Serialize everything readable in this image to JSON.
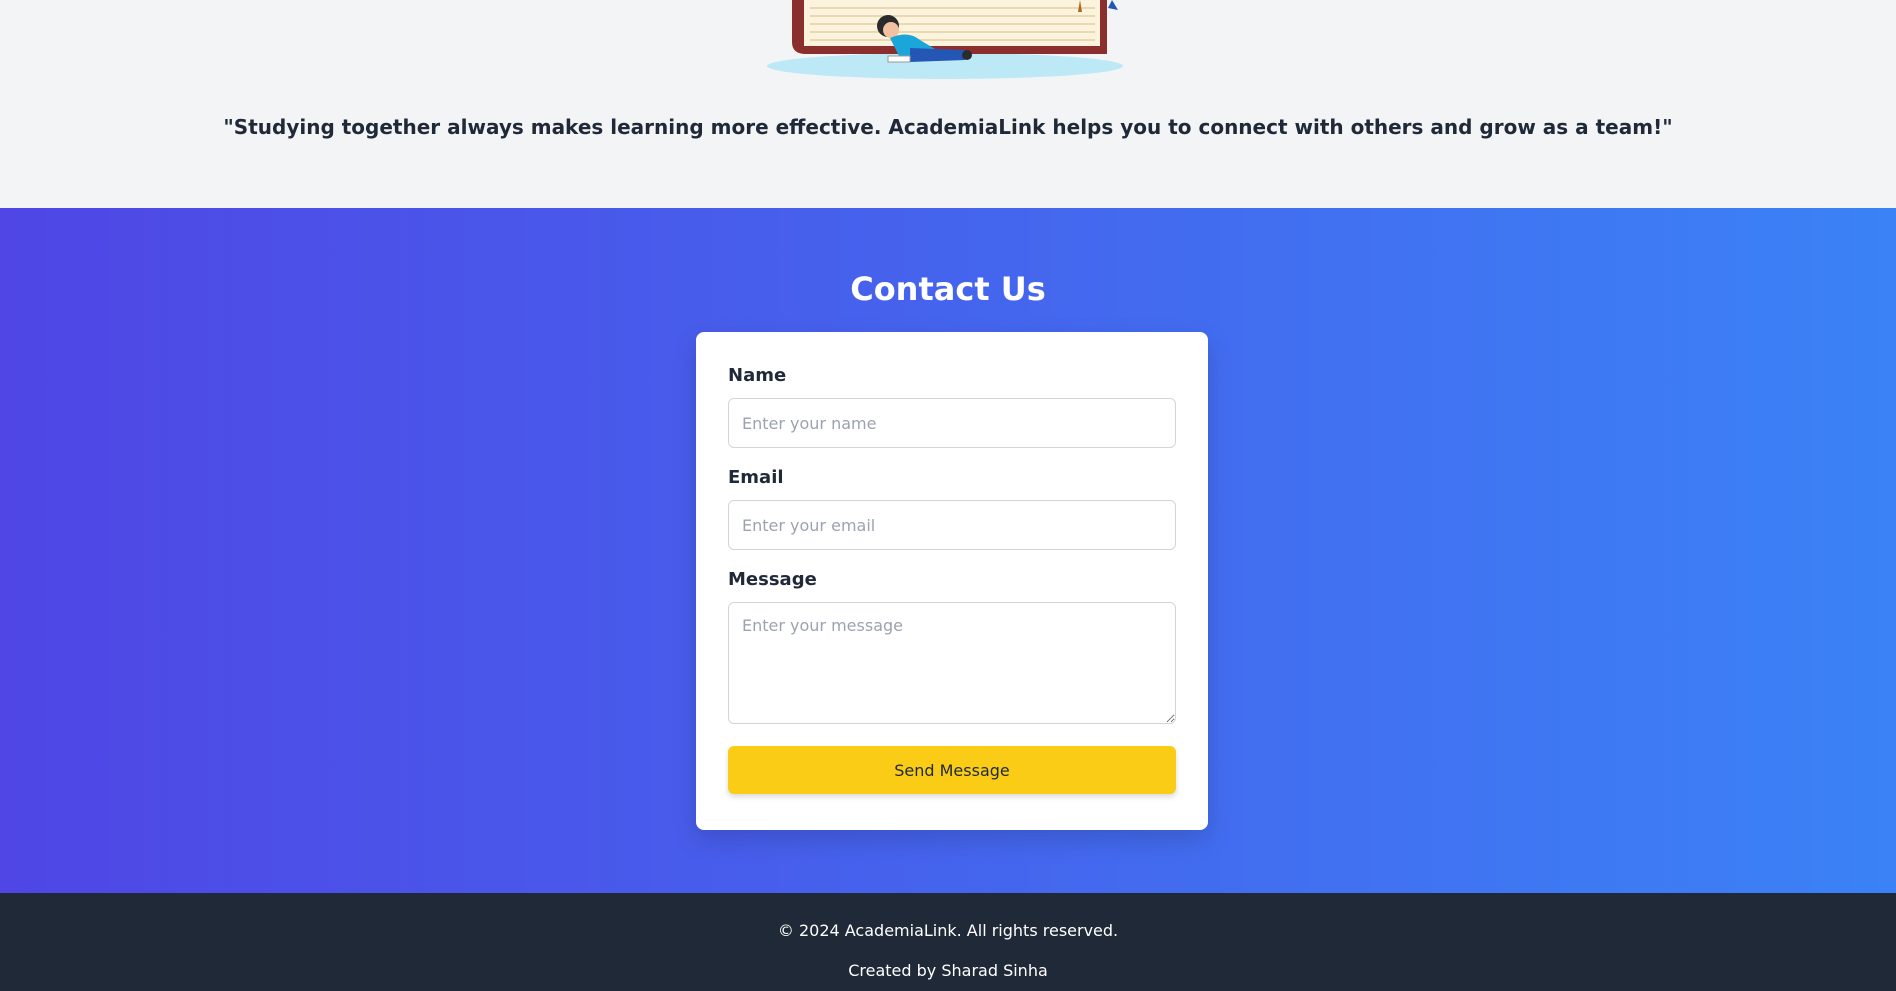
{
  "hero": {
    "quote": "\"Studying together always makes learning more effective. AcademiaLink helps you to connect with others and grow as a team!\""
  },
  "contact": {
    "title": "Contact Us",
    "name_label": "Name",
    "name_placeholder": "Enter your name",
    "email_label": "Email",
    "email_placeholder": "Enter your email",
    "message_label": "Message",
    "message_placeholder": "Enter your message",
    "send_label": "Send Message"
  },
  "footer": {
    "copyright": "© 2024 AcademiaLink. All rights reserved.",
    "credit": "Created by Sharad Sinha"
  },
  "colors": {
    "gradient_start": "#4f46e5",
    "gradient_end": "#3b82f6",
    "button": "#facc15",
    "footer_bg": "#1f2937"
  }
}
